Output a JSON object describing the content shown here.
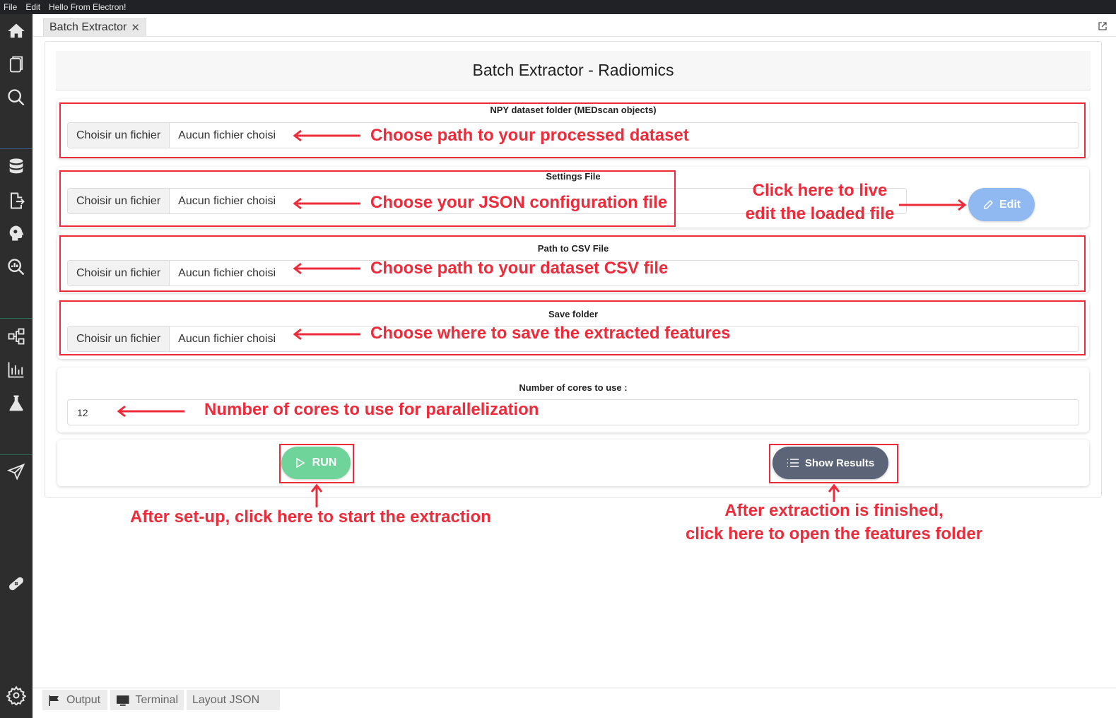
{
  "menubar": {
    "items": [
      "File",
      "Edit",
      "Hello From Electron!"
    ]
  },
  "activitybar": {
    "icons": [
      "home-icon",
      "document-icon",
      "search-icon",
      "database-icon",
      "file-export-icon",
      "brain-icon",
      "analysis-icon",
      "flow-icon",
      "bar-chart-icon",
      "flask-icon",
      "send-icon",
      "bandage-icon",
      "settings-icon"
    ]
  },
  "tabbar": {
    "tab_label": "Batch Extractor",
    "close_glyph": "✕"
  },
  "panel": {
    "title": "Batch Extractor - Radiomics"
  },
  "cards": {
    "npy": {
      "label": "NPY dataset folder (MEDscan objects)",
      "button": "Choisir un fichier",
      "status": "Aucun fichier choisi"
    },
    "settings": {
      "label": "Settings File",
      "button": "Choisir un fichier",
      "status": "Aucun fichier choisi"
    },
    "csv": {
      "label": "Path to CSV File",
      "button": "Choisir un fichier",
      "status": "Aucun fichier choisi"
    },
    "save": {
      "label": "Save folder",
      "button": "Choisir un fichier",
      "status": "Aucun fichier choisi"
    },
    "cores": {
      "label": "Number of cores to use :",
      "value": "12"
    }
  },
  "buttons": {
    "edit": "Edit",
    "run": "RUN",
    "show_results": "Show Results"
  },
  "annotations": {
    "npy": "Choose path to your processed dataset",
    "settings": "Choose your JSON configuration file",
    "edit_line1": "Click here to live",
    "edit_line2": "edit the loaded file",
    "csv": "Choose path to your dataset CSV file",
    "save": "Choose where to save the extracted features",
    "cores": "Number of cores to use for parallelization",
    "run": "After set-up, click here to start the extraction",
    "results_line1": "After extraction is finished,",
    "results_line2": "click here to open the features folder",
    "color": "#ee2b3a"
  },
  "bottom_tabs": [
    "Output",
    "Terminal",
    "Layout JSON"
  ]
}
